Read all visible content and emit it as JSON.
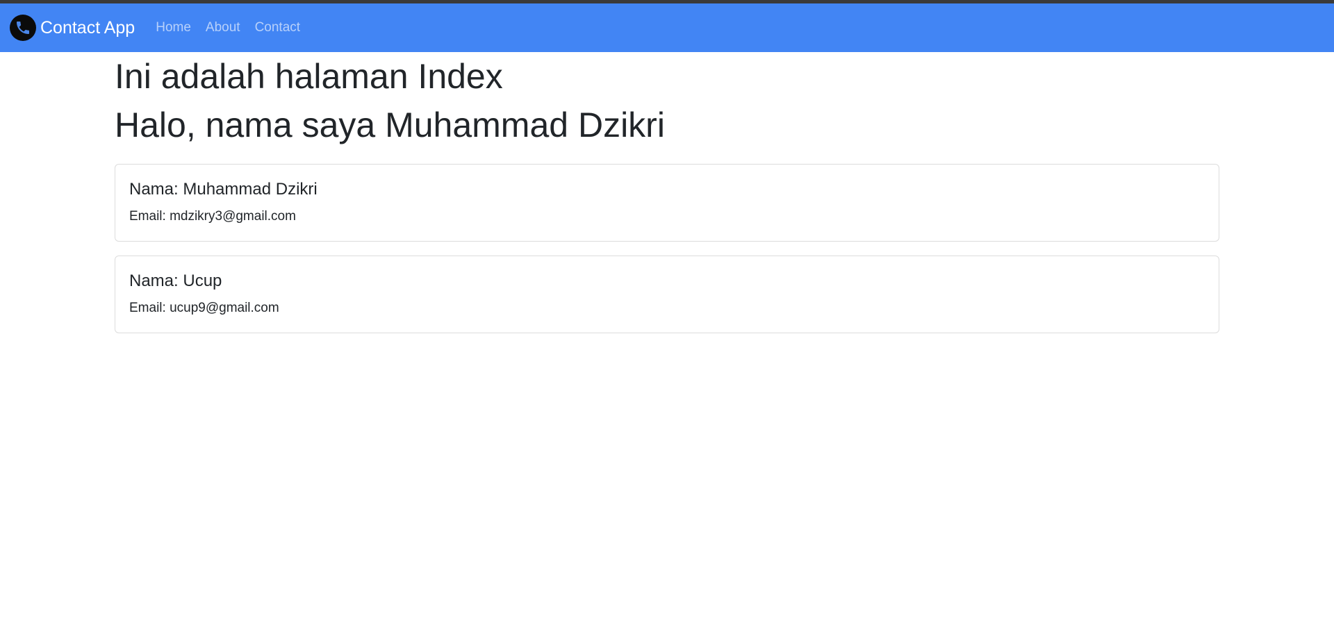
{
  "navbar": {
    "brand": "Contact App",
    "links": [
      "Home",
      "About",
      "Contact"
    ]
  },
  "main": {
    "heading": "Ini adalah halaman Index",
    "greeting": "Halo, nama saya Muhammad Dzikri",
    "contacts": [
      {
        "name": "Nama: Muhammad Dzikri",
        "email": "Email: mdzikry3@gmail.com"
      },
      {
        "name": "Nama: Ucup",
        "email": "Email: ucup9@gmail.com"
      }
    ]
  },
  "colors": {
    "navbar_bg": "#4285f4",
    "top_strip": "#3a3a3a",
    "text": "#212529"
  },
  "icons": {
    "brand": "phone-icon"
  }
}
